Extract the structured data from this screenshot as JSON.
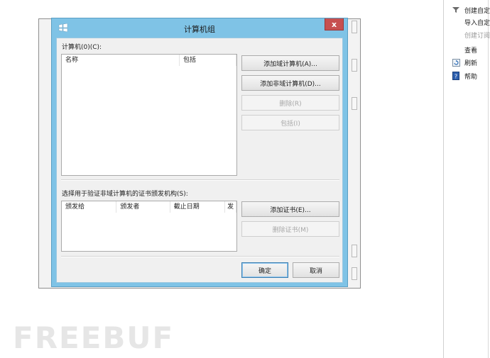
{
  "dialog": {
    "title": "计算机组",
    "close_label": "x",
    "computers_label": "计算机(0)(C):",
    "computers_columns": [
      "名称",
      "包括"
    ],
    "add_domain_button": "添加域计算机(A)...",
    "add_nondomain_button": "添加非域计算机(D)...",
    "remove_button": "删除(R)",
    "include_button": "包括(I)",
    "ca_label": "选择用于验证非域计算机的证书颁发机构(S):",
    "cert_columns": [
      "颁发给",
      "颁发者",
      "截止日期",
      "发"
    ],
    "add_cert_button": "添加证书(E)...",
    "remove_cert_button": "删除证书(M)",
    "ok_button": "确定",
    "cancel_button": "取消"
  },
  "actions_pane": {
    "items": [
      {
        "label": "创建自定",
        "icon": "filter-icon",
        "disabled": false
      },
      {
        "label": "导入自定",
        "icon": "",
        "disabled": false
      },
      {
        "label": "创建订阅",
        "icon": "",
        "disabled": true
      },
      {
        "label": "查看",
        "icon": "",
        "disabled": false
      },
      {
        "label": "刷新",
        "icon": "refresh-icon",
        "disabled": false
      },
      {
        "label": "帮助",
        "icon": "help-icon",
        "disabled": false
      }
    ]
  },
  "watermark": "FREEBUF",
  "colors": {
    "dialog_frame": "#7fc3e6",
    "close_button": "#c75050",
    "client_bg": "#f0f0f0"
  }
}
